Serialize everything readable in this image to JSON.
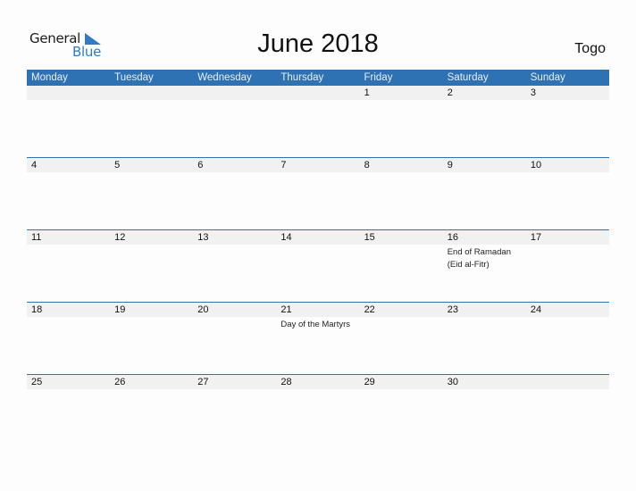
{
  "logo": {
    "line1": "General",
    "line2": "Blue"
  },
  "title": "June 2018",
  "country": "Togo",
  "colors": {
    "accent": "#2e72b4",
    "strip": "#f1f1f1",
    "logo_blue": "#2f7cc6"
  },
  "weekdays": [
    "Monday",
    "Tuesday",
    "Wednesday",
    "Thursday",
    "Friday",
    "Saturday",
    "Sunday"
  ],
  "weeks": [
    {
      "days": [
        {
          "num": "",
          "holiday": ""
        },
        {
          "num": "",
          "holiday": ""
        },
        {
          "num": "",
          "holiday": ""
        },
        {
          "num": "",
          "holiday": ""
        },
        {
          "num": "1",
          "holiday": ""
        },
        {
          "num": "2",
          "holiday": ""
        },
        {
          "num": "3",
          "holiday": ""
        }
      ]
    },
    {
      "days": [
        {
          "num": "4",
          "holiday": ""
        },
        {
          "num": "5",
          "holiday": ""
        },
        {
          "num": "6",
          "holiday": ""
        },
        {
          "num": "7",
          "holiday": ""
        },
        {
          "num": "8",
          "holiday": ""
        },
        {
          "num": "9",
          "holiday": ""
        },
        {
          "num": "10",
          "holiday": ""
        }
      ]
    },
    {
      "days": [
        {
          "num": "11",
          "holiday": ""
        },
        {
          "num": "12",
          "holiday": ""
        },
        {
          "num": "13",
          "holiday": ""
        },
        {
          "num": "14",
          "holiday": ""
        },
        {
          "num": "15",
          "holiday": ""
        },
        {
          "num": "16",
          "holiday": "End of Ramadan (Eid al-Fitr)"
        },
        {
          "num": "17",
          "holiday": ""
        }
      ]
    },
    {
      "days": [
        {
          "num": "18",
          "holiday": ""
        },
        {
          "num": "19",
          "holiday": ""
        },
        {
          "num": "20",
          "holiday": ""
        },
        {
          "num": "21",
          "holiday": "Day of the Martyrs"
        },
        {
          "num": "22",
          "holiday": ""
        },
        {
          "num": "23",
          "holiday": ""
        },
        {
          "num": "24",
          "holiday": ""
        }
      ]
    },
    {
      "days": [
        {
          "num": "25",
          "holiday": ""
        },
        {
          "num": "26",
          "holiday": ""
        },
        {
          "num": "27",
          "holiday": ""
        },
        {
          "num": "28",
          "holiday": ""
        },
        {
          "num": "29",
          "holiday": ""
        },
        {
          "num": "30",
          "holiday": ""
        },
        {
          "num": "",
          "holiday": ""
        }
      ]
    }
  ]
}
